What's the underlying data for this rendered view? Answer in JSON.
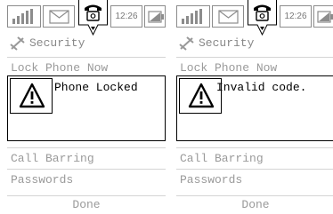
{
  "screens": [
    {
      "status_bar": {
        "time": "12:26",
        "icons": [
          "signal-icon",
          "mail-icon",
          "phone-icon",
          "battery-icon"
        ]
      },
      "menu": {
        "title": "Security",
        "items": [
          "Lock Phone Now",
          "Call Barring",
          "Passwords"
        ],
        "done_label": "Done"
      },
      "dialog": {
        "icon": "warning-icon",
        "message": "Phone Locked"
      }
    },
    {
      "status_bar": {
        "time": "12:26",
        "icons": [
          "signal-icon",
          "mail-icon",
          "phone-icon",
          "battery-icon"
        ]
      },
      "menu": {
        "title": "Security",
        "items": [
          "Lock Phone Now",
          "Call Barring",
          "Passwords"
        ],
        "done_label": "Done"
      },
      "dialog": {
        "icon": "warning-icon",
        "message": "Invalid code."
      }
    }
  ],
  "colors": {
    "text_dim": "#9a9a9a",
    "border": "#8c8c8c",
    "dialog_border": "#000000"
  }
}
